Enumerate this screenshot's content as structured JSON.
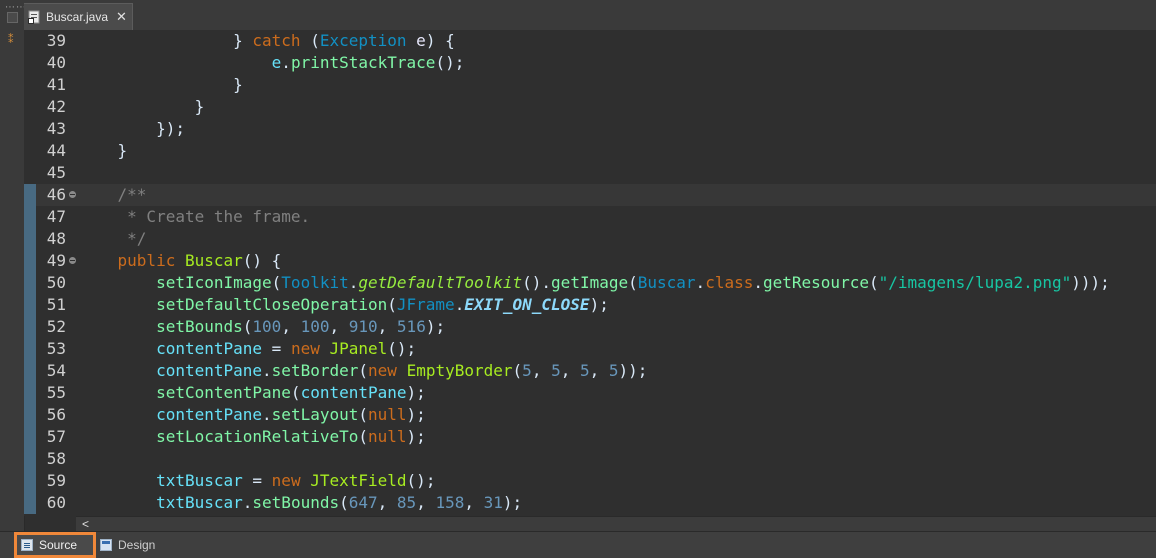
{
  "tab": {
    "title": "Buscar.java",
    "close_glyph": "✕",
    "icon": "java-file-icon"
  },
  "left_strip": {
    "dots": "⋯⋯",
    "icon": "bookmark-icon"
  },
  "editor": {
    "lines": [
      {
        "num": "39",
        "html": "            } <span class='kw'>catch</span> (<span class='ty'>Exception</span> <span class='pl'>e</span>) {"
      },
      {
        "num": "40",
        "html": "                <span class='id'>e</span>.<span class='mt'>printStackTrace</span>();"
      },
      {
        "num": "41",
        "html": "            }"
      },
      {
        "num": "42",
        "html": "        }"
      },
      {
        "num": "43",
        "html": "    });"
      },
      {
        "num": "44",
        "html": "}"
      },
      {
        "num": "45",
        "html": ""
      },
      {
        "num": "46",
        "html": "<span class='cm'>/**</span>",
        "fold": true,
        "current": true
      },
      {
        "num": "47",
        "html": "<span class='cm'> * Create the frame.</span>"
      },
      {
        "num": "48",
        "html": "<span class='cm'> */</span>"
      },
      {
        "num": "49",
        "html": "<span class='kw'>public</span> <span class='fn'>Buscar</span>() {",
        "fold": true
      },
      {
        "num": "50",
        "html": "    <span class='mt'>setIconImage</span>(<span class='ty'>Toolkit</span>.<span class='sm'>getDefaultToolkit</span>().<span class='mt'>getImage</span>(<span class='ty'>Buscar</span>.<span class='kw'>class</span>.<span class='mt'>getResource</span>(<span class='st'>\"/imagens/lupa2.png\"</span>)));"
      },
      {
        "num": "51",
        "html": "    <span class='mt'>setDefaultCloseOperation</span>(<span class='ty'>JFrame</span>.<span class='cst'>EXIT_ON_CLOSE</span>);"
      },
      {
        "num": "52",
        "html": "    <span class='mt'>setBounds</span>(<span class='nm'>100</span>, <span class='nm'>100</span>, <span class='nm'>910</span>, <span class='nm'>516</span>);"
      },
      {
        "num": "53",
        "html": "    <span class='id'>contentPane</span> = <span class='kw'>new</span> <span class='fn'>JPanel</span>();"
      },
      {
        "num": "54",
        "html": "    <span class='id'>contentPane</span>.<span class='mt'>setBorder</span>(<span class='kw'>new</span> <span class='fn'>EmptyBorder</span>(<span class='nm'>5</span>, <span class='nm'>5</span>, <span class='nm'>5</span>, <span class='nm'>5</span>));"
      },
      {
        "num": "55",
        "html": "    <span class='mt'>setContentPane</span>(<span class='id'>contentPane</span>);"
      },
      {
        "num": "56",
        "html": "    <span class='id'>contentPane</span>.<span class='mt'>setLayout</span>(<span class='kw'>null</span>);"
      },
      {
        "num": "57",
        "html": "    <span class='mt'>setLocationRelativeTo</span>(<span class='kw'>null</span>);"
      },
      {
        "num": "58",
        "html": ""
      },
      {
        "num": "59",
        "html": "    <span class='id'>txtBuscar</span> = <span class='kw'>new</span> <span class='fn'>JTextField</span>();"
      },
      {
        "num": "60",
        "html": "    <span class='id'>txtBuscar</span>.<span class='mt'>setBounds</span>(<span class='nm'>647</span>, <span class='nm'>85</span>, <span class='nm'>158</span>, <span class='nm'>31</span>);"
      }
    ]
  },
  "scrollbar": {
    "left_arrow": "<"
  },
  "bottom_tabs": {
    "source": "Source",
    "design": "Design"
  }
}
